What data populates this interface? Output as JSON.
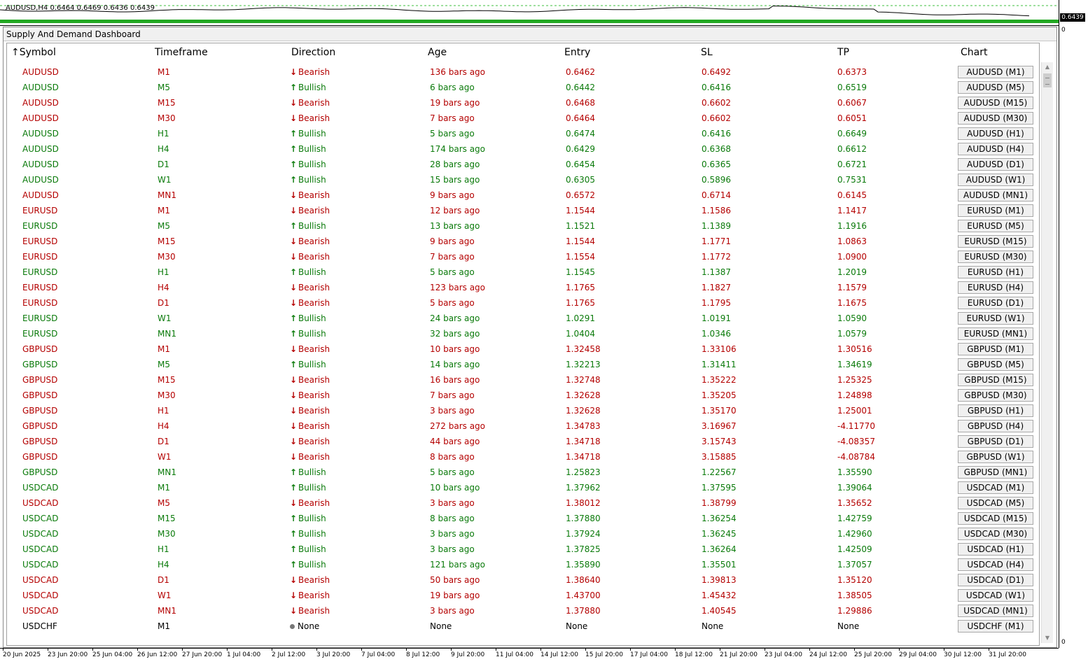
{
  "chart": {
    "symbol_info": "AUDUSD,H4  0.6464 0.6469 0.6436 0.6439",
    "price_tag": "0.6439",
    "scale_top": "0",
    "scale_bottom": "0"
  },
  "dashboard": {
    "title": "Supply And Demand Dashboard",
    "columns": [
      "Symbol",
      "Timeframe",
      "Direction",
      "Age",
      "Entry",
      "SL",
      "TP",
      "Chart"
    ],
    "sort_indicator": "↑",
    "rows": [
      {
        "symbol": "AUDUSD",
        "tf": "M1",
        "dir": "Bearish",
        "age": "136 bars ago",
        "entry": "0.6462",
        "sl": "0.6492",
        "tp": "0.6373",
        "chart": "AUDUSD (M1)"
      },
      {
        "symbol": "AUDUSD",
        "tf": "M5",
        "dir": "Bullish",
        "age": "6 bars ago",
        "entry": "0.6442",
        "sl": "0.6416",
        "tp": "0.6519",
        "chart": "AUDUSD (M5)"
      },
      {
        "symbol": "AUDUSD",
        "tf": "M15",
        "dir": "Bearish",
        "age": "19 bars ago",
        "entry": "0.6468",
        "sl": "0.6602",
        "tp": "0.6067",
        "chart": "AUDUSD (M15)"
      },
      {
        "symbol": "AUDUSD",
        "tf": "M30",
        "dir": "Bearish",
        "age": "7 bars ago",
        "entry": "0.6464",
        "sl": "0.6602",
        "tp": "0.6051",
        "chart": "AUDUSD (M30)"
      },
      {
        "symbol": "AUDUSD",
        "tf": "H1",
        "dir": "Bullish",
        "age": "5 bars ago",
        "entry": "0.6474",
        "sl": "0.6416",
        "tp": "0.6649",
        "chart": "AUDUSD (H1)"
      },
      {
        "symbol": "AUDUSD",
        "tf": "H4",
        "dir": "Bullish",
        "age": "174 bars ago",
        "entry": "0.6429",
        "sl": "0.6368",
        "tp": "0.6612",
        "chart": "AUDUSD (H4)"
      },
      {
        "symbol": "AUDUSD",
        "tf": "D1",
        "dir": "Bullish",
        "age": "28 bars ago",
        "entry": "0.6454",
        "sl": "0.6365",
        "tp": "0.6721",
        "chart": "AUDUSD (D1)"
      },
      {
        "symbol": "AUDUSD",
        "tf": "W1",
        "dir": "Bullish",
        "age": "15 bars ago",
        "entry": "0.6305",
        "sl": "0.5896",
        "tp": "0.7531",
        "chart": "AUDUSD (W1)"
      },
      {
        "symbol": "AUDUSD",
        "tf": "MN1",
        "dir": "Bearish",
        "age": "9 bars ago",
        "entry": "0.6572",
        "sl": "0.6714",
        "tp": "0.6145",
        "chart": "AUDUSD (MN1)"
      },
      {
        "symbol": "EURUSD",
        "tf": "M1",
        "dir": "Bearish",
        "age": "12 bars ago",
        "entry": "1.1544",
        "sl": "1.1586",
        "tp": "1.1417",
        "chart": "EURUSD (M1)"
      },
      {
        "symbol": "EURUSD",
        "tf": "M5",
        "dir": "Bullish",
        "age": "13 bars ago",
        "entry": "1.1521",
        "sl": "1.1389",
        "tp": "1.1916",
        "chart": "EURUSD (M5)"
      },
      {
        "symbol": "EURUSD",
        "tf": "M15",
        "dir": "Bearish",
        "age": "9 bars ago",
        "entry": "1.1544",
        "sl": "1.1771",
        "tp": "1.0863",
        "chart": "EURUSD (M15)"
      },
      {
        "symbol": "EURUSD",
        "tf": "M30",
        "dir": "Bearish",
        "age": "7 bars ago",
        "entry": "1.1554",
        "sl": "1.1772",
        "tp": "1.0900",
        "chart": "EURUSD (M30)"
      },
      {
        "symbol": "EURUSD",
        "tf": "H1",
        "dir": "Bullish",
        "age": "5 bars ago",
        "entry": "1.1545",
        "sl": "1.1387",
        "tp": "1.2019",
        "chart": "EURUSD (H1)"
      },
      {
        "symbol": "EURUSD",
        "tf": "H4",
        "dir": "Bearish",
        "age": "123 bars ago",
        "entry": "1.1765",
        "sl": "1.1827",
        "tp": "1.1579",
        "chart": "EURUSD (H4)"
      },
      {
        "symbol": "EURUSD",
        "tf": "D1",
        "dir": "Bearish",
        "age": "5 bars ago",
        "entry": "1.1765",
        "sl": "1.1795",
        "tp": "1.1675",
        "chart": "EURUSD (D1)"
      },
      {
        "symbol": "EURUSD",
        "tf": "W1",
        "dir": "Bullish",
        "age": "24 bars ago",
        "entry": "1.0291",
        "sl": "1.0191",
        "tp": "1.0590",
        "chart": "EURUSD (W1)"
      },
      {
        "symbol": "EURUSD",
        "tf": "MN1",
        "dir": "Bullish",
        "age": "32 bars ago",
        "entry": "1.0404",
        "sl": "1.0346",
        "tp": "1.0579",
        "chart": "EURUSD (MN1)"
      },
      {
        "symbol": "GBPUSD",
        "tf": "M1",
        "dir": "Bearish",
        "age": "10 bars ago",
        "entry": "1.32458",
        "sl": "1.33106",
        "tp": "1.30516",
        "chart": "GBPUSD (M1)"
      },
      {
        "symbol": "GBPUSD",
        "tf": "M5",
        "dir": "Bullish",
        "age": "14 bars ago",
        "entry": "1.32213",
        "sl": "1.31411",
        "tp": "1.34619",
        "chart": "GBPUSD (M5)"
      },
      {
        "symbol": "GBPUSD",
        "tf": "M15",
        "dir": "Bearish",
        "age": "16 bars ago",
        "entry": "1.32748",
        "sl": "1.35222",
        "tp": "1.25325",
        "chart": "GBPUSD (M15)"
      },
      {
        "symbol": "GBPUSD",
        "tf": "M30",
        "dir": "Bearish",
        "age": "7 bars ago",
        "entry": "1.32628",
        "sl": "1.35205",
        "tp": "1.24898",
        "chart": "GBPUSD (M30)"
      },
      {
        "symbol": "GBPUSD",
        "tf": "H1",
        "dir": "Bearish",
        "age": "3 bars ago",
        "entry": "1.32628",
        "sl": "1.35170",
        "tp": "1.25001",
        "chart": "GBPUSD (H1)"
      },
      {
        "symbol": "GBPUSD",
        "tf": "H4",
        "dir": "Bearish",
        "age": "272 bars ago",
        "entry": "1.34783",
        "sl": "3.16967",
        "tp": "-4.11770",
        "chart": "GBPUSD (H4)"
      },
      {
        "symbol": "GBPUSD",
        "tf": "D1",
        "dir": "Bearish",
        "age": "44 bars ago",
        "entry": "1.34718",
        "sl": "3.15743",
        "tp": "-4.08357",
        "chart": "GBPUSD (D1)"
      },
      {
        "symbol": "GBPUSD",
        "tf": "W1",
        "dir": "Bearish",
        "age": "8 bars ago",
        "entry": "1.34718",
        "sl": "3.15885",
        "tp": "-4.08784",
        "chart": "GBPUSD (W1)"
      },
      {
        "symbol": "GBPUSD",
        "tf": "MN1",
        "dir": "Bullish",
        "age": "5 bars ago",
        "entry": "1.25823",
        "sl": "1.22567",
        "tp": "1.35590",
        "chart": "GBPUSD (MN1)"
      },
      {
        "symbol": "USDCAD",
        "tf": "M1",
        "dir": "Bullish",
        "age": "10 bars ago",
        "entry": "1.37962",
        "sl": "1.37595",
        "tp": "1.39064",
        "chart": "USDCAD (M1)"
      },
      {
        "symbol": "USDCAD",
        "tf": "M5",
        "dir": "Bearish",
        "age": "3 bars ago",
        "entry": "1.38012",
        "sl": "1.38799",
        "tp": "1.35652",
        "chart": "USDCAD (M5)"
      },
      {
        "symbol": "USDCAD",
        "tf": "M15",
        "dir": "Bullish",
        "age": "8 bars ago",
        "entry": "1.37880",
        "sl": "1.36254",
        "tp": "1.42759",
        "chart": "USDCAD (M15)"
      },
      {
        "symbol": "USDCAD",
        "tf": "M30",
        "dir": "Bullish",
        "age": "3 bars ago",
        "entry": "1.37924",
        "sl": "1.36245",
        "tp": "1.42960",
        "chart": "USDCAD (M30)"
      },
      {
        "symbol": "USDCAD",
        "tf": "H1",
        "dir": "Bullish",
        "age": "3 bars ago",
        "entry": "1.37825",
        "sl": "1.36264",
        "tp": "1.42509",
        "chart": "USDCAD (H1)"
      },
      {
        "symbol": "USDCAD",
        "tf": "H4",
        "dir": "Bullish",
        "age": "121 bars ago",
        "entry": "1.35890",
        "sl": "1.35501",
        "tp": "1.37057",
        "chart": "USDCAD (H4)"
      },
      {
        "symbol": "USDCAD",
        "tf": "D1",
        "dir": "Bearish",
        "age": "50 bars ago",
        "entry": "1.38640",
        "sl": "1.39813",
        "tp": "1.35120",
        "chart": "USDCAD (D1)"
      },
      {
        "symbol": "USDCAD",
        "tf": "W1",
        "dir": "Bearish",
        "age": "19 bars ago",
        "entry": "1.43700",
        "sl": "1.45432",
        "tp": "1.38505",
        "chart": "USDCAD (W1)"
      },
      {
        "symbol": "USDCAD",
        "tf": "MN1",
        "dir": "Bearish",
        "age": "3 bars ago",
        "entry": "1.37880",
        "sl": "1.40545",
        "tp": "1.29886",
        "chart": "USDCAD (MN1)"
      },
      {
        "symbol": "USDCHF",
        "tf": "M1",
        "dir": "None",
        "age": "None",
        "entry": "None",
        "sl": "None",
        "tp": "None",
        "chart": "USDCHF (M1)"
      }
    ]
  },
  "time_axis": [
    "20 Jun 2025",
    "23 Jun 20:00",
    "25 Jun 04:00",
    "26 Jun 12:00",
    "27 Jun 20:00",
    "1 Jul 04:00",
    "2 Jul 12:00",
    "3 Jul 20:00",
    "7 Jul 04:00",
    "8 Jul 12:00",
    "9 Jul 20:00",
    "11 Jul 04:00",
    "14 Jul 12:00",
    "15 Jul 20:00",
    "17 Jul 04:00",
    "18 Jul 12:00",
    "21 Jul 20:00",
    "23 Jul 04:00",
    "24 Jul 12:00",
    "25 Jul 20:00",
    "29 Jul 04:00",
    "30 Jul 12:00",
    "31 Jul 20:00"
  ],
  "colors": {
    "bearish": "#b40000",
    "bullish": "#0a7a0a",
    "neutral": "#000000",
    "button_bg": "#f0f0f0"
  },
  "icons": {
    "bearish": "arrow-down-icon",
    "bullish": "arrow-up-icon",
    "none": "dot-icon"
  }
}
